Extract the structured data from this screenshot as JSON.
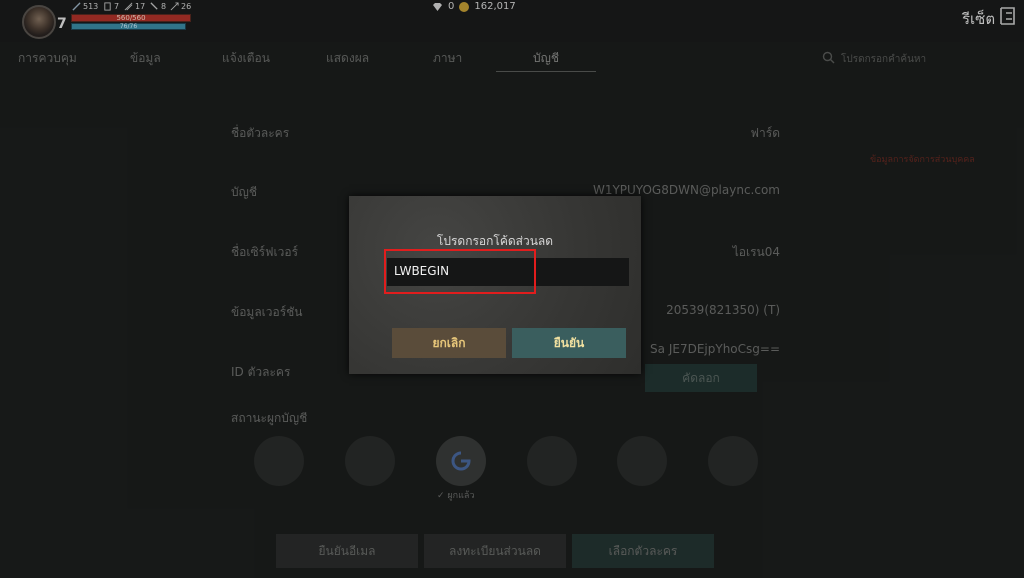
{
  "player": {
    "level": "7",
    "stats": [
      "513",
      "7",
      "17",
      "8",
      "26"
    ],
    "hp": "560/560",
    "mp": "76/76"
  },
  "currency": {
    "gems": "0",
    "gold": "162,017"
  },
  "header": {
    "reset_label": "รีเซ็ต"
  },
  "tabs": [
    "การควบคุม",
    "ข้อมูล",
    "แจ้งเตือน",
    "แสดงผล",
    "ภาษา",
    "บัญชี"
  ],
  "active_tab": "บัญชี",
  "search": {
    "placeholder": "โปรดกรอกคำค้นหา"
  },
  "account": {
    "character_name_label": "ชื่อตัวละคร",
    "character_name_value": "ฟาร์ด",
    "account_label": "บัญชี",
    "account_value": "W1YPUYOG8DWN@plaync.com",
    "server_label": "ชื่อเซิร์ฟเวอร์",
    "server_value": "ไอเรน04",
    "version_label": "ข้อมูลเวอร์ชัน",
    "version_value": "20539(821350) (T)",
    "id_label": "ID ตัวละคร",
    "id_value": "Sa JE7DEjpYhoCsg==",
    "copy_label": "คัดลอก",
    "link_label": "สถานะผูกบัญชี",
    "linked_label": "ผูกแล้ว",
    "side_hint": "ข้อมูลการจัดการส่วนบุคคล"
  },
  "bottom_buttons": [
    "ยืนยันอีเมล",
    "ลงทะเบียนส่วนลด",
    "เลือกตัวละคร"
  ],
  "dialog": {
    "title": "โปรดกรอกโค้ดส่วนลด",
    "code_value": "LWBEGIN",
    "cancel_label": "ยกเลิก",
    "confirm_label": "ยืนยัน"
  },
  "colors": {
    "hp": "#b2322a",
    "mp": "#3c8ea8",
    "highlight": "#e11d1d"
  }
}
